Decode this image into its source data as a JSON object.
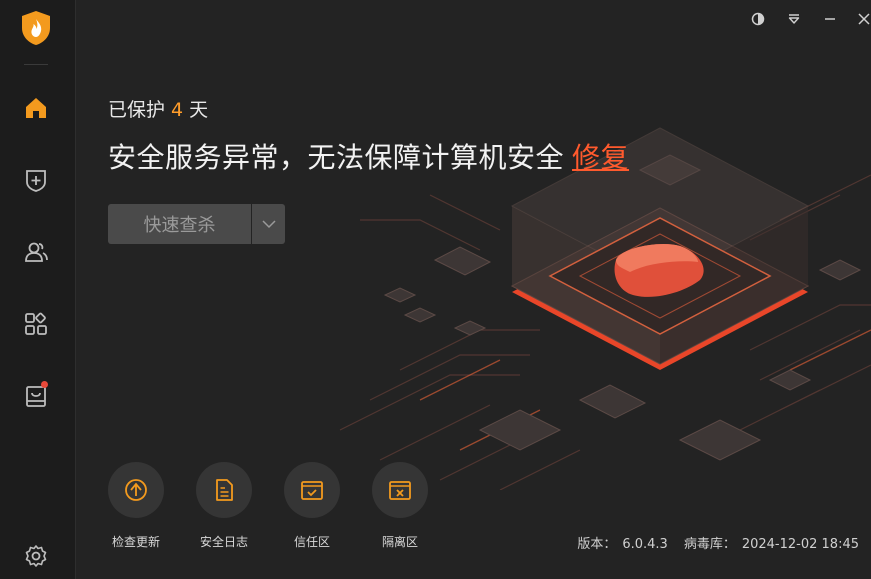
{
  "sidebar": {
    "logo": "shield-flame-logo",
    "items": [
      {
        "icon": "home-icon",
        "active": true
      },
      {
        "icon": "shield-plus-icon"
      },
      {
        "icon": "users-icon"
      },
      {
        "icon": "apps-icon"
      },
      {
        "icon": "store-icon",
        "badge": true
      }
    ],
    "settings_icon": "gear-icon"
  },
  "titlebar": {
    "buttons": [
      "theme-icon",
      "menu-icon",
      "minimize-icon",
      "close-icon"
    ]
  },
  "main": {
    "protected_prefix": "已保护",
    "protected_days": "4",
    "protected_suffix": "天",
    "headline": "安全服务异常，无法保障计算机安全",
    "fix_label": "修复",
    "scan_button": "快速查杀"
  },
  "tools": [
    {
      "label": "检查更新",
      "icon": "update-icon"
    },
    {
      "label": "安全日志",
      "icon": "log-icon"
    },
    {
      "label": "信任区",
      "icon": "trust-icon"
    },
    {
      "label": "隔离区",
      "icon": "quarantine-icon"
    }
  ],
  "footer": {
    "version_label": "版本：",
    "version_value": "6.0.4.3",
    "virus_db_label": "病毒库：",
    "virus_db_value": "2024-12-02 18:45"
  },
  "colors": {
    "accent": "#ff9d2b",
    "alert": "#ff5a2d",
    "background": "#232323",
    "sidebar": "#1c1c1c"
  }
}
